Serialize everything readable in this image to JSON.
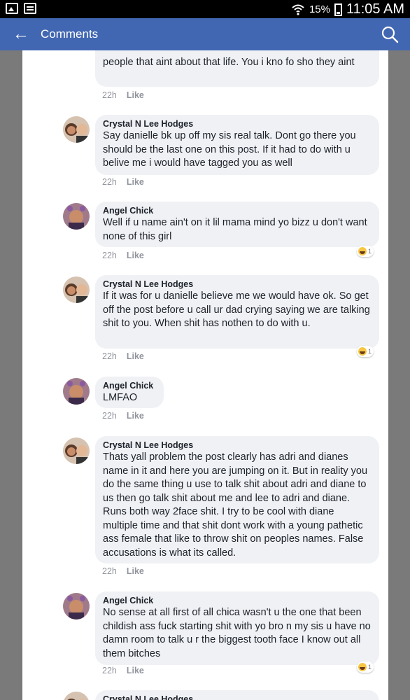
{
  "status": {
    "battery": "15%",
    "time": "11:05 AM"
  },
  "header": {
    "title": "Comments"
  },
  "comments": [
    {
      "author": "",
      "text": "people that aint about that life. You i kno fo sho they aint",
      "time": "22h",
      "like": "Like"
    },
    {
      "author": "Crystal N Lee Hodges",
      "text": "Say danielle bk up off my sis real talk. Dont go there you should be the last one on this post. If it had to do with u belive me i would have tagged you as well",
      "time": "22h",
      "like": "Like"
    },
    {
      "author": "Angel Chick",
      "text": "Well if u name ain't on it lil  mama  mind yo  bizz u don't want none  of this girl",
      "time": "22h",
      "like": "Like",
      "reaction_count": "1"
    },
    {
      "author": "Crystal N Lee Hodges",
      "text": "If it was for u danielle believe me we would have ok. So get off the post before u call ur dad crying saying we are talking shit to you. When shit has nothen to do with u.",
      "time": "22h",
      "like": "Like",
      "reaction_count": "1"
    },
    {
      "author": "Angel Chick",
      "text": "LMFAO",
      "time": "22h",
      "like": "Like"
    },
    {
      "author": "Crystal N Lee Hodges",
      "text": "Thats yall problem the post clearly has adri and dianes name in it and here you are jumping on it. But in reality you do the same thing u use to talk shit about adri and diane to us then go talk shit about me and lee to adri and diane. Runs both way 2face shit. I try to be cool with diane multiple time and that shit dont work with a young pathetic ass female that like to throw shit on peoples names. False accusations is what its called.",
      "time": "22h",
      "like": "Like"
    },
    {
      "author": "Angel Chick",
      "text": "No sense  at all first of all chica  wasn't u the one that been childish ass  fuck  starting shit with yo  bro  n my sis  u have no damn room to talk u r the biggest tooth face I know out all them bitches",
      "time": "22h",
      "like": "Like",
      "reaction_count": "1"
    },
    {
      "author": "Crystal N Lee Hodges"
    }
  ],
  "colors": {
    "header": "#4267b2",
    "bubble": "#eff1f5",
    "meta": "#90949c"
  },
  "icons": {
    "back": "back-arrow-icon",
    "search": "search-icon",
    "reaction": "haha-reaction-icon"
  }
}
